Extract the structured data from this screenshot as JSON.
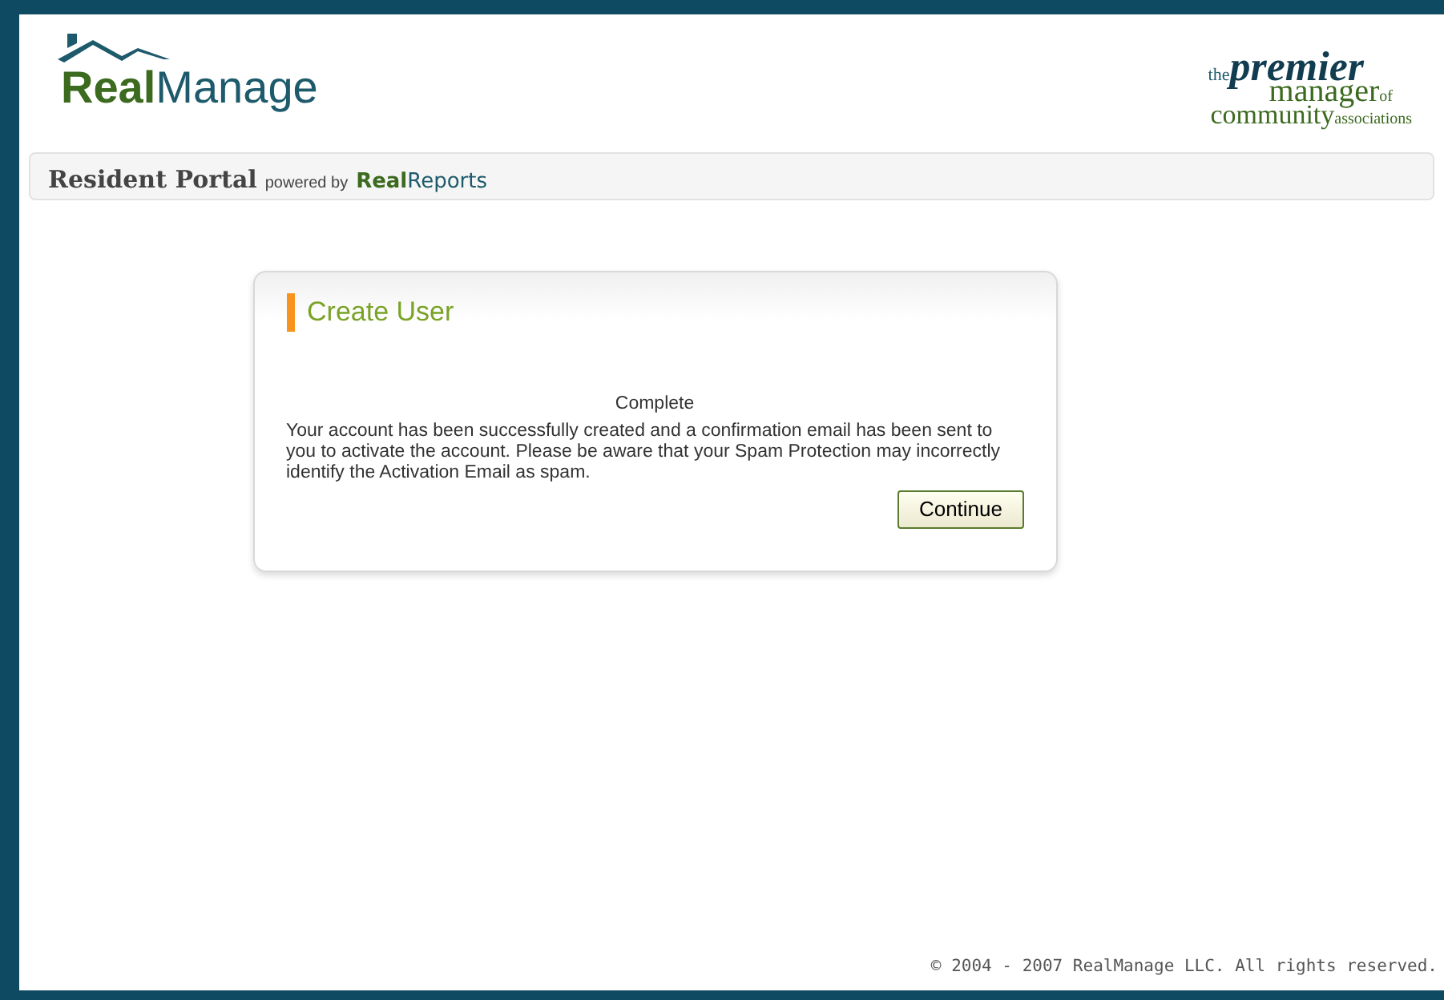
{
  "logo": {
    "part_1": "Real",
    "part_2": "Manage"
  },
  "tagline": {
    "part_1": "the",
    "part_2": "premier",
    "part_3": "manager",
    "part_4": "of",
    "part_5": "community",
    "part_6": "associations"
  },
  "portal_bar": {
    "title": "Resident Portal",
    "powered_by": "powered by",
    "brand_part_1": "Real",
    "brand_part_2": "Reports"
  },
  "panel": {
    "title": "Create User",
    "status": "Complete",
    "message": "Your account has been successfully created and a confirmation email has been sent to you to activate the account. Please be aware that your Spam Protection may incorrectly identify the Activation Email as spam.",
    "button": "Continue"
  },
  "footer": "© 2004 - 2007 RealManage LLC. All rights reserved."
}
